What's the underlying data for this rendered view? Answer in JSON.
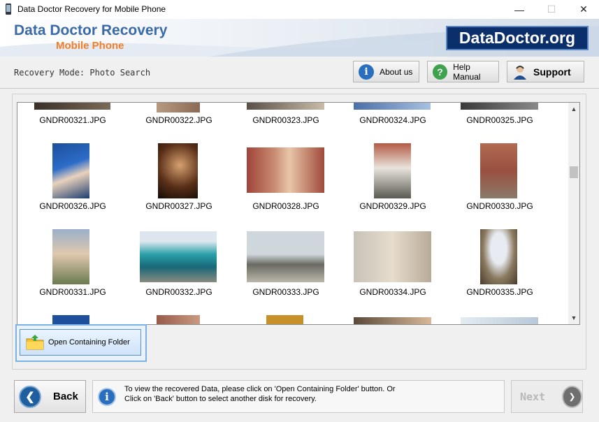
{
  "window": {
    "title": "Data Doctor Recovery for Mobile Phone",
    "minimize": "—",
    "maximize": "☐",
    "close": "✕"
  },
  "header": {
    "brand_line1": "Data Doctor Recovery",
    "brand_line2": "Mobile Phone",
    "logo_text": "DataDoctor.org"
  },
  "toolbar": {
    "mode_label": "Recovery Mode: Photo Search",
    "about_label": "About us",
    "help_label": "Help Manual",
    "support_label": "Support"
  },
  "gallery": {
    "row0": [
      "GNDR00321.JPG",
      "GNDR00322.JPG",
      "GNDR00323.JPG",
      "GNDR00324.JPG",
      "GNDR00325.JPG"
    ],
    "row1": [
      "GNDR00326.JPG",
      "GNDR00327.JPG",
      "GNDR00328.JPG",
      "GNDR00329.JPG",
      "GNDR00330.JPG"
    ],
    "row2": [
      "GNDR00331.JPG",
      "GNDR00332.JPG",
      "GNDR00333.JPG",
      "GNDR00334.JPG",
      "GNDR00335.JPG"
    ]
  },
  "open_folder_label": "Open Containing Folder",
  "footer": {
    "back_label": "Back",
    "info_line1": "To view the recovered Data, please click on 'Open Containing Folder' button. Or",
    "info_line2": "Click on 'Back' button to select another disk for recovery.",
    "next_label": "Next"
  },
  "colors": {
    "brand_blue": "#3a6aa8",
    "brand_orange": "#f07f2c",
    "logo_bg": "#0a2f6b"
  }
}
